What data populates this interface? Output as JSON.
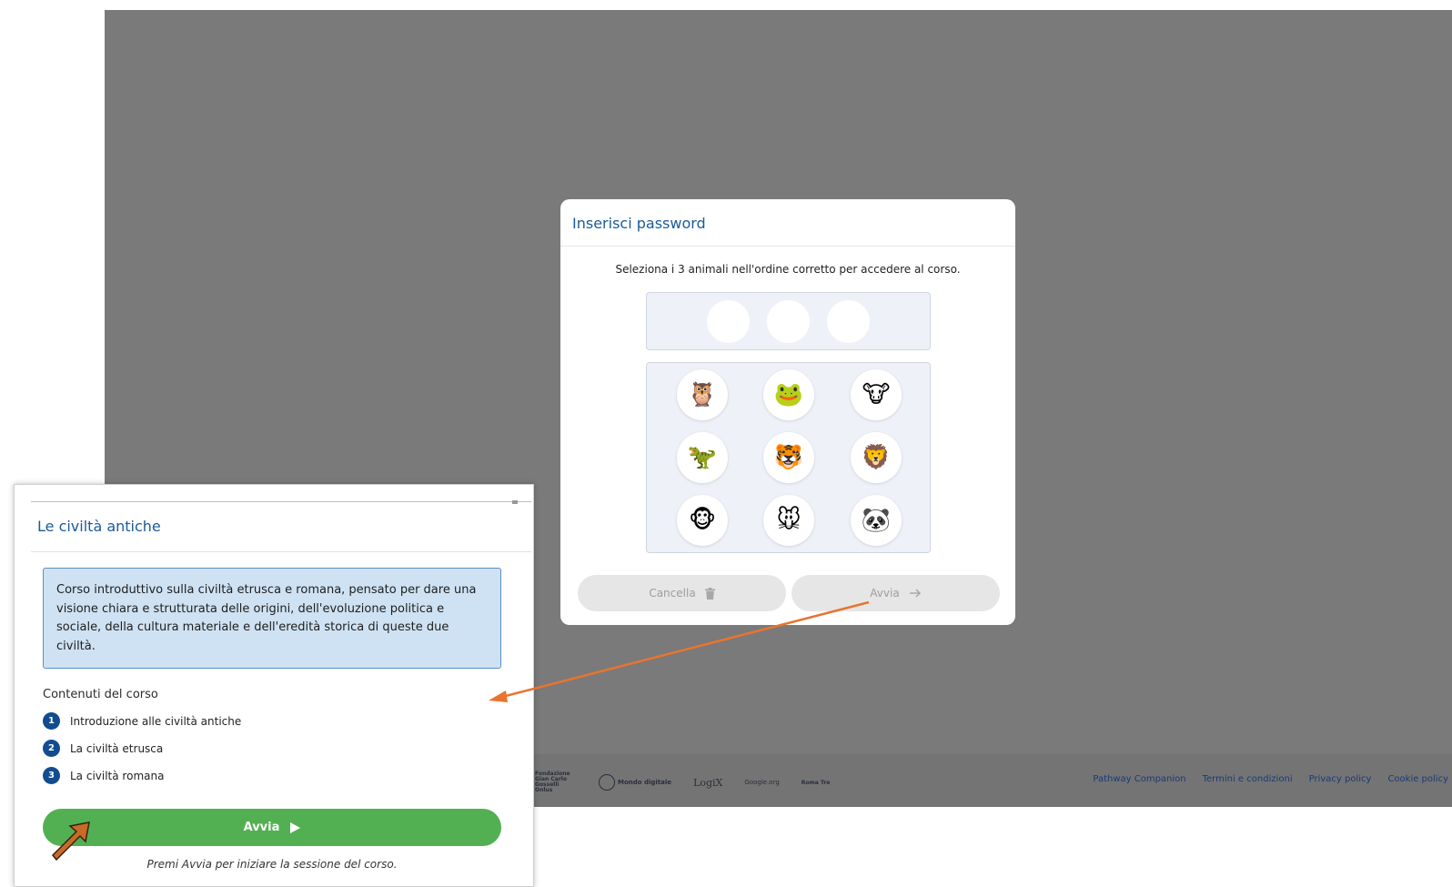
{
  "background": {
    "footer_logos": [
      "Fondazione Gian Carlo Gosselli Onlus",
      "Mondo digitale",
      "LogiX",
      "Google.org",
      "Roma Tre"
    ],
    "footer_links": [
      "Pathway Companion",
      "Termini e condizioni",
      "Privacy policy",
      "Cookie policy"
    ]
  },
  "password_modal": {
    "title": "Inserisci password",
    "instruction": "Seleziona i 3 animali nell'ordine corretto per accedere al corso.",
    "slots_count": 3,
    "animals": [
      {
        "name": "owl",
        "glyph": "🦉"
      },
      {
        "name": "frog",
        "glyph": "🐸"
      },
      {
        "name": "cow",
        "glyph": "🐮"
      },
      {
        "name": "dinosaur",
        "glyph": "🦖"
      },
      {
        "name": "tiger",
        "glyph": "🐯"
      },
      {
        "name": "lion",
        "glyph": "🦁"
      },
      {
        "name": "monkey",
        "glyph": "🐵"
      },
      {
        "name": "mouse",
        "glyph": "🐭"
      },
      {
        "name": "panda",
        "glyph": "🐼"
      }
    ],
    "cancel_label": "Cancella",
    "start_label": "Avvia",
    "button_color": "#e6e6e6"
  },
  "course_card": {
    "title": "Le civiltà antiche",
    "description": "Corso introduttivo sulla civiltà etrusca e romana, pensato per dare una visione chiara e strutturata delle origini, dell'evoluzione politica e sociale, della cultura materiale e dell'eredità storica di queste due civiltà.",
    "contents_title": "Contenuti del corso",
    "lessons": [
      {
        "num": "1",
        "label": "Introduzione alle civiltà antiche"
      },
      {
        "num": "2",
        "label": "La civiltà etrusca"
      },
      {
        "num": "3",
        "label": "La civiltà romana"
      }
    ],
    "start_label": "Avvia",
    "hint": "Premi Avvia per iniziare la sessione del corso.",
    "accent_color": "#52b053",
    "title_color": "#1b5a9a"
  },
  "annotations": {
    "arrow_color": "#e8742f"
  }
}
